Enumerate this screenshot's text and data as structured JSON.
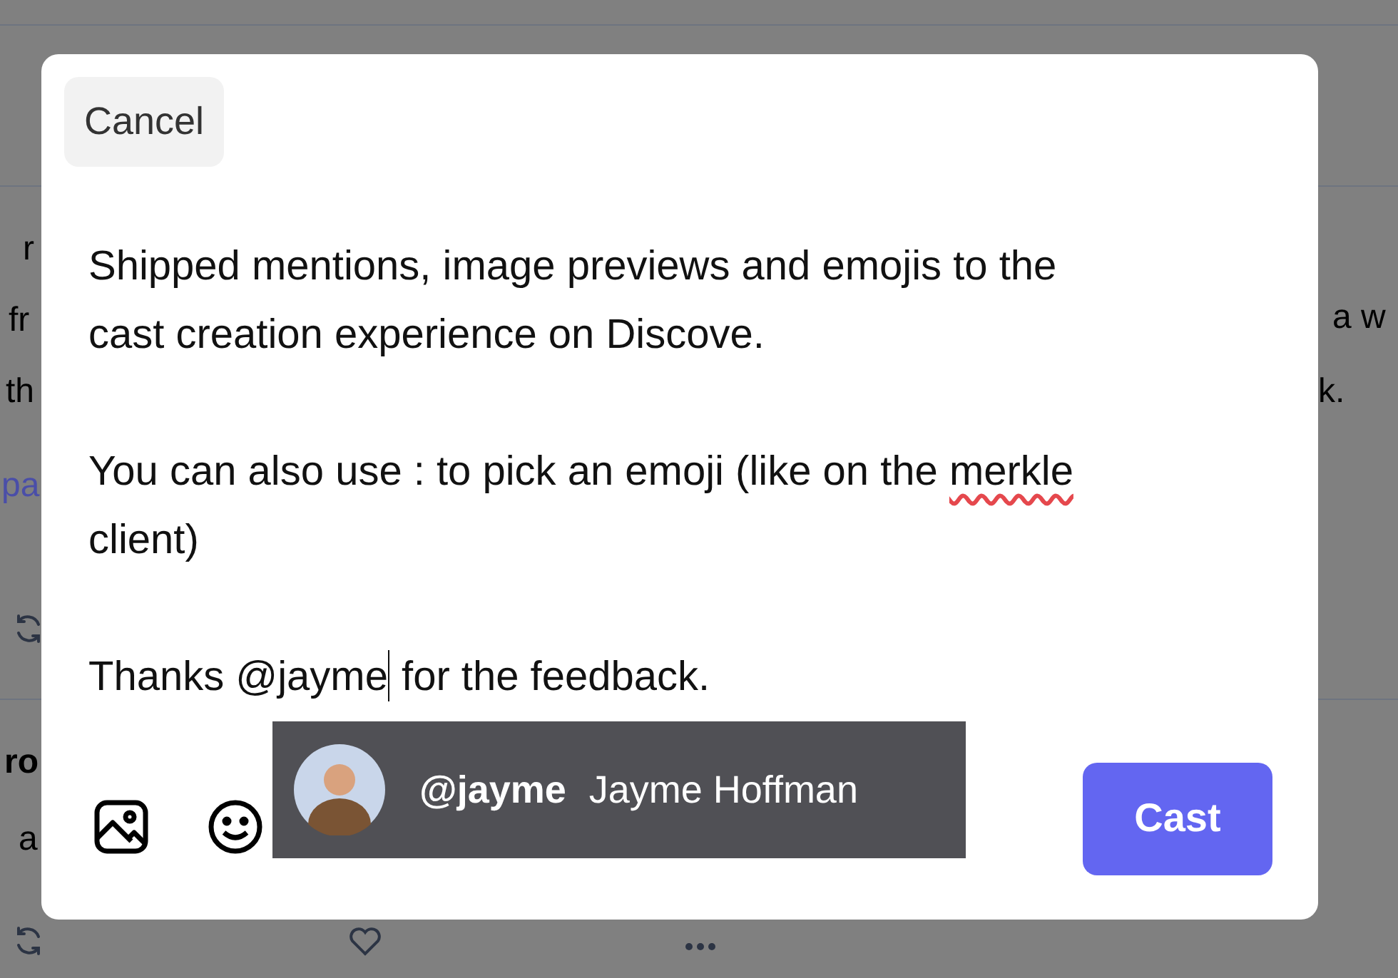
{
  "background": {
    "fragments": [
      {
        "text": "r",
        "kind": "text"
      },
      {
        "text": "fr",
        "kind": "text"
      },
      {
        "text": "th",
        "kind": "text"
      },
      {
        "text": "pa",
        "kind": "link"
      },
      {
        "text": "ro",
        "kind": "bold"
      },
      {
        "text": "a",
        "kind": "text"
      },
      {
        "text": "a w",
        "kind": "text"
      },
      {
        "text": "k.",
        "kind": "text"
      }
    ]
  },
  "dialog": {
    "cancel": "Cancel",
    "paragraphs": [
      {
        "parts": [
          {
            "text": "Shipped mentions, image previews and emojis to the cast creation experience on Discove."
          }
        ]
      },
      {
        "parts": [
          {
            "text": "You can also use : to pick an emoji (like on the "
          },
          {
            "text": "merkle",
            "misspelled": true
          },
          {
            "text": " client)"
          }
        ]
      },
      {
        "parts": [
          {
            "text": "Thanks @jayme",
            "caret": true
          },
          {
            "text": " for the feedback."
          }
        ]
      }
    ],
    "mention": {
      "handle": "@jayme",
      "name": "Jayme Hoffman"
    },
    "submit": "Cast"
  }
}
